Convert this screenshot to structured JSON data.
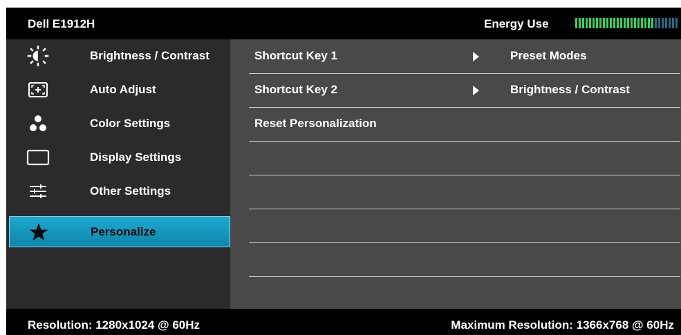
{
  "header": {
    "model": "Dell E1912H",
    "energy_label": "Energy Use",
    "energy_level": 0.78
  },
  "sidebar": {
    "items": [
      {
        "label": "Brightness / Contrast",
        "icon": "brightness-icon"
      },
      {
        "label": "Auto Adjust",
        "icon": "auto-adjust-icon"
      },
      {
        "label": "Color Settings",
        "icon": "color-settings-icon"
      },
      {
        "label": "Display Settings",
        "icon": "display-settings-icon"
      },
      {
        "label": "Other Settings",
        "icon": "other-settings-icon"
      },
      {
        "label": "Personalize",
        "icon": "star-icon",
        "selected": true
      }
    ]
  },
  "content": {
    "rows": [
      {
        "label": "Shortcut Key 1",
        "value": "Preset Modes"
      },
      {
        "label": "Shortcut Key 2",
        "value": "Brightness / Contrast"
      },
      {
        "label": "Reset Personalization",
        "value": ""
      },
      {
        "label": "",
        "value": ""
      },
      {
        "label": "",
        "value": ""
      },
      {
        "label": "",
        "value": ""
      },
      {
        "label": "",
        "value": ""
      }
    ]
  },
  "footer": {
    "resolution": "Resolution: 1280x1024 @ 60Hz",
    "max_resolution": "Maximum Resolution: 1366x768 @ 60Hz"
  },
  "colors": {
    "selected": "#1ea8cf",
    "energy_on": "#2fd65a",
    "energy_off": "#2a6a8a"
  }
}
